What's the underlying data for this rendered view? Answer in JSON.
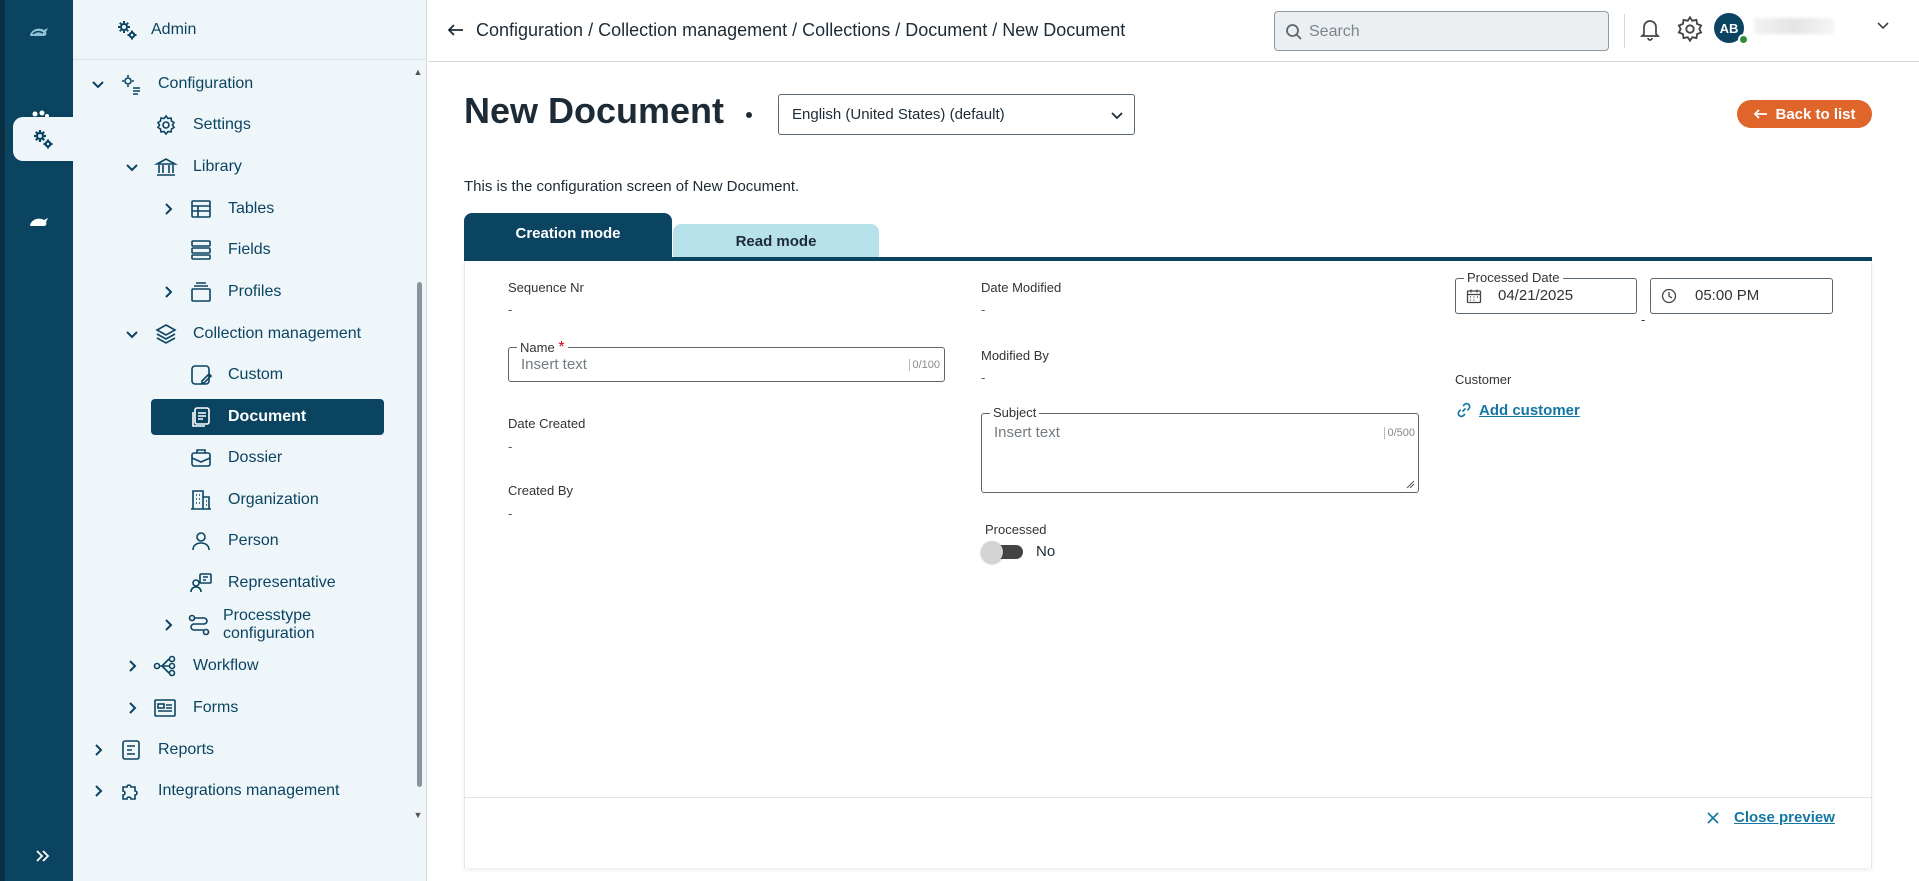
{
  "sidebar": {
    "header": "Admin",
    "items": [
      {
        "label": "Configuration"
      },
      {
        "label": "Settings"
      },
      {
        "label": "Library"
      },
      {
        "label": "Tables"
      },
      {
        "label": "Fields"
      },
      {
        "label": "Profiles"
      },
      {
        "label": "Collection management"
      },
      {
        "label": "Custom"
      },
      {
        "label": "Document"
      },
      {
        "label": "Dossier"
      },
      {
        "label": "Organization"
      },
      {
        "label": "Person"
      },
      {
        "label": "Representative"
      },
      {
        "label": "Processtype configuration"
      },
      {
        "label": "Workflow"
      },
      {
        "label": "Forms"
      },
      {
        "label": "Reports"
      },
      {
        "label": "Integrations management"
      }
    ],
    "active_item": "Document"
  },
  "topbar": {
    "breadcrumb": "Configuration / Collection management / Collections / Document / New Document",
    "search_placeholder": "Search",
    "avatar_initials": "AB"
  },
  "main": {
    "title": "New Document",
    "language": "English (United States) (default)",
    "back_label": "Back to list",
    "description": "This is the configuration screen of New Document.",
    "tabs": [
      {
        "label": "Creation mode",
        "active": true
      },
      {
        "label": "Read mode",
        "active": false
      }
    ]
  },
  "form": {
    "sequence_nr": {
      "label": "Sequence Nr",
      "value": "-"
    },
    "name": {
      "label": "Name",
      "placeholder": "Insert text",
      "counter": "0/100",
      "required_mark": "*"
    },
    "date_created": {
      "label": "Date Created",
      "value": "-"
    },
    "created_by": {
      "label": "Created By",
      "value": "-"
    },
    "date_modified": {
      "label": "Date Modified",
      "value": "-"
    },
    "modified_by": {
      "label": "Modified By",
      "value": "-"
    },
    "subject": {
      "label": "Subject",
      "placeholder": "Insert text",
      "counter": "0/500"
    },
    "processed": {
      "label": "Processed",
      "value_text": "No",
      "on": false
    },
    "processed_date": {
      "label": "Processed Date",
      "date": "04/21/2025",
      "time": "05:00 PM",
      "trailing": "-"
    },
    "customer": {
      "label": "Customer",
      "action": "Add customer"
    }
  },
  "footer": {
    "close_label": "Close preview"
  },
  "colors": {
    "primary": "#0b4461",
    "accent": "#e0652b",
    "link": "#1377a3",
    "read_tab": "#b7e1eb",
    "sidebar_bg": "#eef6fa"
  }
}
